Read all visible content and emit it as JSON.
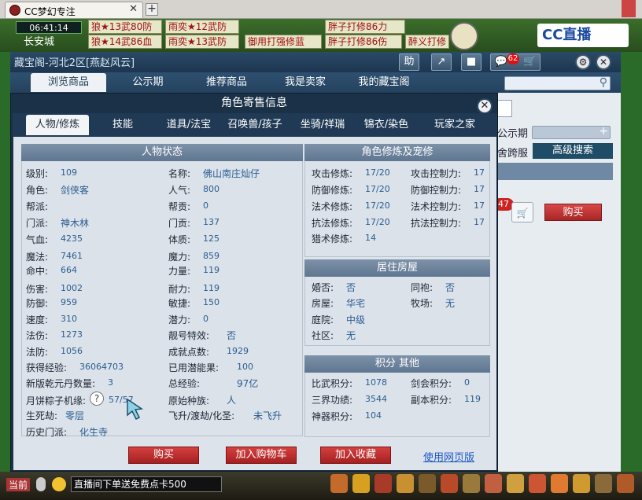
{
  "browser": {
    "tab_title": "CC梦幻专注",
    "close": "✕",
    "new_tab": "+"
  },
  "game_top": {
    "clock": "06:41:14",
    "city": "长安城",
    "rankings_row1": [
      "狼★13武80防",
      "雨奕★12武防",
      "胖子打修86力"
    ],
    "rankings_row2": [
      "狼★14武86血",
      "雨奕★13武防",
      "御用打强修蓝",
      "胖子打修86伤",
      "醉义打修"
    ],
    "cc_logo": "CC直播"
  },
  "window": {
    "title": "藏宝阁-河北2区[燕赵风云]",
    "header_buttons": {
      "help": "助",
      "share": "↗",
      "stop": "■",
      "chat": "💬",
      "chat_count": "62",
      "cart": "🛒",
      "settings": "⚙",
      "close": "✕"
    },
    "nav_tabs": [
      "浏览商品",
      "公示期",
      "推荐商品",
      "我是卖家",
      "我的藏宝阁"
    ],
    "search_icon": "⚲"
  },
  "background_panel": {
    "label_public": "公示期",
    "label_cross": "舍跨服",
    "advanced_search": "高级搜索",
    "badge": "47",
    "buy": "购买"
  },
  "dialog": {
    "title": "角色寄售信息",
    "close": "✕",
    "tabs": [
      "人物/修炼",
      "技能",
      "道具/法宝",
      "召唤兽/孩子",
      "坐骑/祥瑞",
      "锦衣/染色",
      "玩家之家"
    ],
    "status": {
      "heading": "人物状态",
      "level_label": "级别:",
      "level": "109",
      "name_label": "名称:",
      "name": "佛山南庄灿仔",
      "role_label": "角色:",
      "role": "剑侠客",
      "popularity_label": "人气:",
      "popularity": "800",
      "gang_label": "帮派:",
      "gang": "",
      "gang_contrib_label": "帮贡:",
      "gang_contrib": "0",
      "school_label": "门派:",
      "school": "神木林",
      "school_contrib_label": "门贡:",
      "school_contrib": "137",
      "hp_label": "气血:",
      "hp": "4235",
      "physique_label": "体质:",
      "physique": "125",
      "mp_label": "魔法:",
      "mp": "7461",
      "magic_label": "魔力:",
      "magic": "859",
      "hit_label": "命中:",
      "hit": "664",
      "strength_label": "力量:",
      "strength": "119",
      "damage_label": "伤害:",
      "damage": "1002",
      "endurance_label": "耐力:",
      "endurance": "119",
      "defense_label": "防御:",
      "defense": "959",
      "agility_label": "敏捷:",
      "agility": "150",
      "speed_label": "速度:",
      "speed": "310",
      "potential_label": "潜力:",
      "potential": "0",
      "spell_dmg_label": "法伤:",
      "spell_dmg": "1273",
      "pretty_label": "靓号特效:",
      "pretty": "否",
      "spell_def_label": "法防:",
      "spell_def": "1056",
      "achievement_label": "成就点数:",
      "achievement": "1929",
      "exp_label": "获得经验:",
      "exp": "36064703",
      "used_potential_label": "已用潜能果:",
      "used_potential": "100",
      "qianyuan_label": "新版乾元丹数量:",
      "qianyuan": "3",
      "total_exp_label": "总经验:",
      "total_exp": "97亿",
      "zongzi_label": "月饼粽子机缘:",
      "zongzi": "57/57",
      "race_label": "原始种族:",
      "race": "人",
      "reborn_label": "生死劫:",
      "reborn": "零层",
      "ascend_label": "飞升/渡劫/化圣:",
      "ascend": "未飞升",
      "history_label": "历史门派:",
      "history": "化生寺"
    },
    "cultivation": {
      "heading": "角色修炼及宠修",
      "attack_label": "攻击修炼:",
      "attack": "17/20",
      "attack_ctrl_label": "攻击控制力:",
      "attack_ctrl": "17",
      "defense_label": "防御修炼:",
      "defense": "17/20",
      "defense_ctrl_label": "防御控制力:",
      "defense_ctrl": "17",
      "spell_label": "法术修炼:",
      "spell": "17/20",
      "spell_ctrl_label": "法术控制力:",
      "spell_ctrl": "17",
      "resist_label": "抗法修炼:",
      "resist": "17/20",
      "resist_ctrl_label": "抗法控制力:",
      "resist_ctrl": "17",
      "hunt_label": "猎术修炼:",
      "hunt": "14"
    },
    "housing": {
      "heading": "居住房屋",
      "married_label": "婚否:",
      "married": "否",
      "robe_label": "同袍:",
      "robe": "否",
      "house_label": "房屋:",
      "house": "华宅",
      "ranch_label": "牧场:",
      "ranch": "无",
      "yard_label": "庭院:",
      "yard": "中级",
      "community_label": "社区:",
      "community": "无"
    },
    "points": {
      "heading": "积分 其他",
      "martial_label": "比武积分:",
      "martial": "1078",
      "sword_label": "剑会积分:",
      "sword": "0",
      "merit_label": "三界功绩:",
      "merit": "3544",
      "dungeon_label": "副本积分:",
      "dungeon": "119",
      "beast_label": "神器积分:",
      "beast": "104"
    },
    "buttons": {
      "buy": "购买",
      "add_cart": "加入购物车",
      "add_fav": "加入收藏",
      "web": "使用网页版"
    }
  },
  "bottom": {
    "current": "当前",
    "chat_text": "直播间下单送免费点卡500"
  }
}
